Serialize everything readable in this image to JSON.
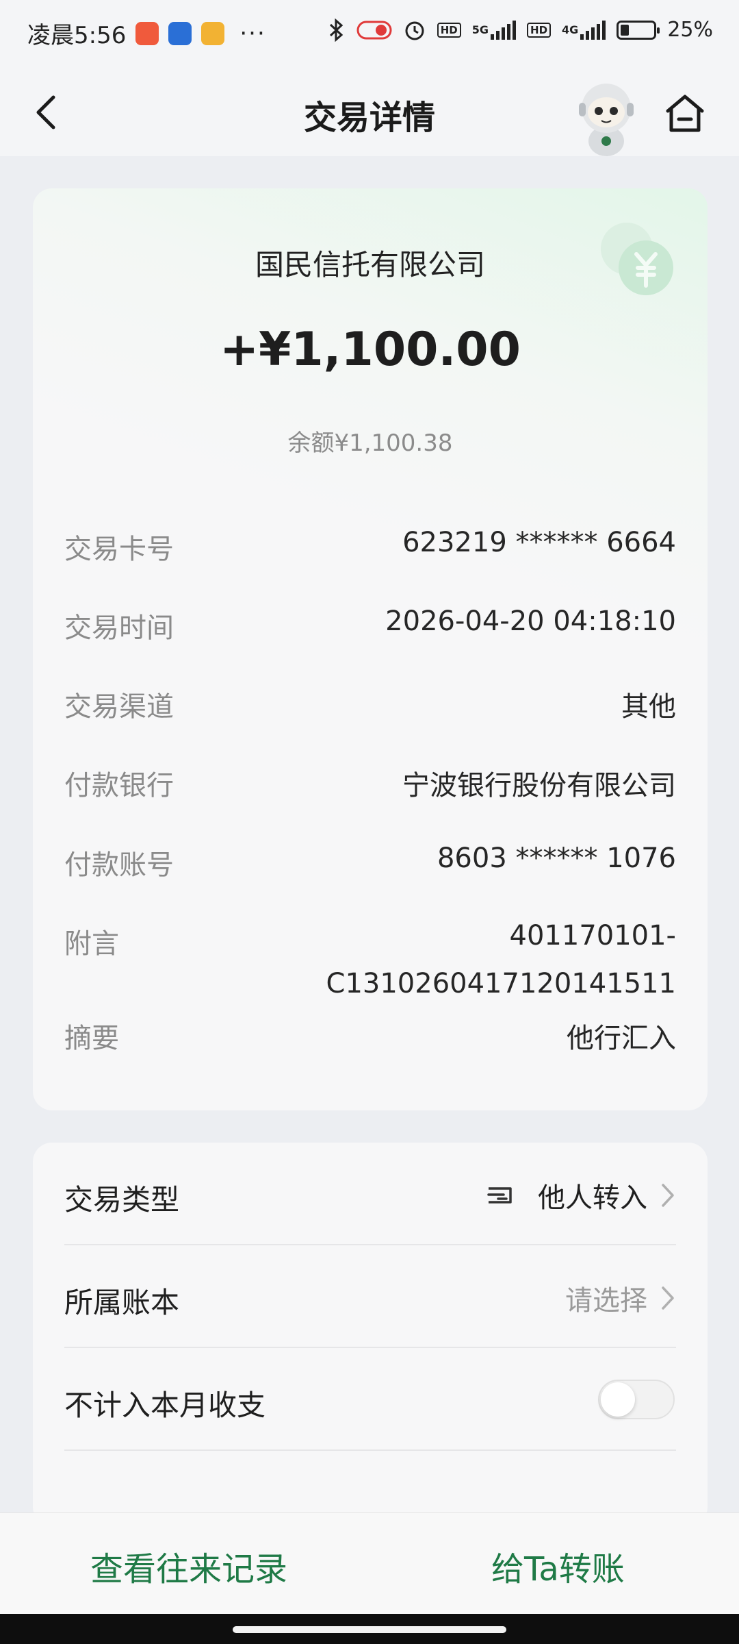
{
  "status_bar": {
    "time": "凌晨5:56",
    "more": "···",
    "network1": "5G",
    "network2": "4G",
    "hd": "HD",
    "battery_text": "25%",
    "battery_level": 0.25
  },
  "header": {
    "title": "交易详情"
  },
  "detail": {
    "payee": "国民信托有限公司",
    "amount": "+¥1,100.00",
    "balance": "余额¥1,100.38",
    "rows": [
      {
        "label": "交易卡号",
        "value": "623219 ****** 6664"
      },
      {
        "label": "交易时间",
        "value": "2026-04-20 04:18:10"
      },
      {
        "label": "交易渠道",
        "value": "其他"
      },
      {
        "label": "付款银行",
        "value": "宁波银行股份有限公司"
      },
      {
        "label": "付款账号",
        "value": "8603 ****** 1076"
      },
      {
        "label": "附言",
        "value_line1": "401170101-",
        "value_line2": "C1310260417120141511"
      },
      {
        "label": "摘要",
        "value": "他行汇入"
      }
    ]
  },
  "options": {
    "type_label": "交易类型",
    "type_value": "他人转入",
    "book_label": "所属账本",
    "book_placeholder": "请选择",
    "exclude_label": "不计入本月收支",
    "exclude_on": false
  },
  "bottom": {
    "history_label": "查看往来记录",
    "transfer_label": "给Ta转账"
  },
  "colors": {
    "accent": "#1f7a46",
    "label_gray": "#8a8a8a",
    "bg": "#eceef2"
  }
}
